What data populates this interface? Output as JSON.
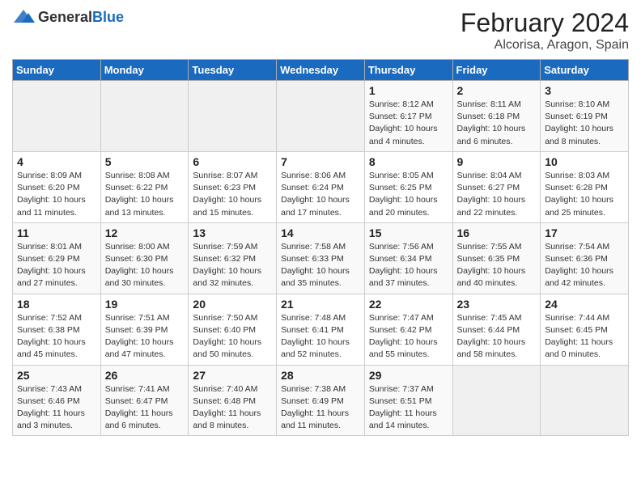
{
  "header": {
    "logo_general": "General",
    "logo_blue": "Blue",
    "title": "February 2024",
    "subtitle": "Alcorisa, Aragon, Spain"
  },
  "calendar": {
    "days_of_week": [
      "Sunday",
      "Monday",
      "Tuesday",
      "Wednesday",
      "Thursday",
      "Friday",
      "Saturday"
    ],
    "weeks": [
      [
        {
          "day": "",
          "info": ""
        },
        {
          "day": "",
          "info": ""
        },
        {
          "day": "",
          "info": ""
        },
        {
          "day": "",
          "info": ""
        },
        {
          "day": "1",
          "info": "Sunrise: 8:12 AM\nSunset: 6:17 PM\nDaylight: 10 hours\nand 4 minutes."
        },
        {
          "day": "2",
          "info": "Sunrise: 8:11 AM\nSunset: 6:18 PM\nDaylight: 10 hours\nand 6 minutes."
        },
        {
          "day": "3",
          "info": "Sunrise: 8:10 AM\nSunset: 6:19 PM\nDaylight: 10 hours\nand 8 minutes."
        }
      ],
      [
        {
          "day": "4",
          "info": "Sunrise: 8:09 AM\nSunset: 6:20 PM\nDaylight: 10 hours\nand 11 minutes."
        },
        {
          "day": "5",
          "info": "Sunrise: 8:08 AM\nSunset: 6:22 PM\nDaylight: 10 hours\nand 13 minutes."
        },
        {
          "day": "6",
          "info": "Sunrise: 8:07 AM\nSunset: 6:23 PM\nDaylight: 10 hours\nand 15 minutes."
        },
        {
          "day": "7",
          "info": "Sunrise: 8:06 AM\nSunset: 6:24 PM\nDaylight: 10 hours\nand 17 minutes."
        },
        {
          "day": "8",
          "info": "Sunrise: 8:05 AM\nSunset: 6:25 PM\nDaylight: 10 hours\nand 20 minutes."
        },
        {
          "day": "9",
          "info": "Sunrise: 8:04 AM\nSunset: 6:27 PM\nDaylight: 10 hours\nand 22 minutes."
        },
        {
          "day": "10",
          "info": "Sunrise: 8:03 AM\nSunset: 6:28 PM\nDaylight: 10 hours\nand 25 minutes."
        }
      ],
      [
        {
          "day": "11",
          "info": "Sunrise: 8:01 AM\nSunset: 6:29 PM\nDaylight: 10 hours\nand 27 minutes."
        },
        {
          "day": "12",
          "info": "Sunrise: 8:00 AM\nSunset: 6:30 PM\nDaylight: 10 hours\nand 30 minutes."
        },
        {
          "day": "13",
          "info": "Sunrise: 7:59 AM\nSunset: 6:32 PM\nDaylight: 10 hours\nand 32 minutes."
        },
        {
          "day": "14",
          "info": "Sunrise: 7:58 AM\nSunset: 6:33 PM\nDaylight: 10 hours\nand 35 minutes."
        },
        {
          "day": "15",
          "info": "Sunrise: 7:56 AM\nSunset: 6:34 PM\nDaylight: 10 hours\nand 37 minutes."
        },
        {
          "day": "16",
          "info": "Sunrise: 7:55 AM\nSunset: 6:35 PM\nDaylight: 10 hours\nand 40 minutes."
        },
        {
          "day": "17",
          "info": "Sunrise: 7:54 AM\nSunset: 6:36 PM\nDaylight: 10 hours\nand 42 minutes."
        }
      ],
      [
        {
          "day": "18",
          "info": "Sunrise: 7:52 AM\nSunset: 6:38 PM\nDaylight: 10 hours\nand 45 minutes."
        },
        {
          "day": "19",
          "info": "Sunrise: 7:51 AM\nSunset: 6:39 PM\nDaylight: 10 hours\nand 47 minutes."
        },
        {
          "day": "20",
          "info": "Sunrise: 7:50 AM\nSunset: 6:40 PM\nDaylight: 10 hours\nand 50 minutes."
        },
        {
          "day": "21",
          "info": "Sunrise: 7:48 AM\nSunset: 6:41 PM\nDaylight: 10 hours\nand 52 minutes."
        },
        {
          "day": "22",
          "info": "Sunrise: 7:47 AM\nSunset: 6:42 PM\nDaylight: 10 hours\nand 55 minutes."
        },
        {
          "day": "23",
          "info": "Sunrise: 7:45 AM\nSunset: 6:44 PM\nDaylight: 10 hours\nand 58 minutes."
        },
        {
          "day": "24",
          "info": "Sunrise: 7:44 AM\nSunset: 6:45 PM\nDaylight: 11 hours\nand 0 minutes."
        }
      ],
      [
        {
          "day": "25",
          "info": "Sunrise: 7:43 AM\nSunset: 6:46 PM\nDaylight: 11 hours\nand 3 minutes."
        },
        {
          "day": "26",
          "info": "Sunrise: 7:41 AM\nSunset: 6:47 PM\nDaylight: 11 hours\nand 6 minutes."
        },
        {
          "day": "27",
          "info": "Sunrise: 7:40 AM\nSunset: 6:48 PM\nDaylight: 11 hours\nand 8 minutes."
        },
        {
          "day": "28",
          "info": "Sunrise: 7:38 AM\nSunset: 6:49 PM\nDaylight: 11 hours\nand 11 minutes."
        },
        {
          "day": "29",
          "info": "Sunrise: 7:37 AM\nSunset: 6:51 PM\nDaylight: 11 hours\nand 14 minutes."
        },
        {
          "day": "",
          "info": ""
        },
        {
          "day": "",
          "info": ""
        }
      ]
    ]
  }
}
